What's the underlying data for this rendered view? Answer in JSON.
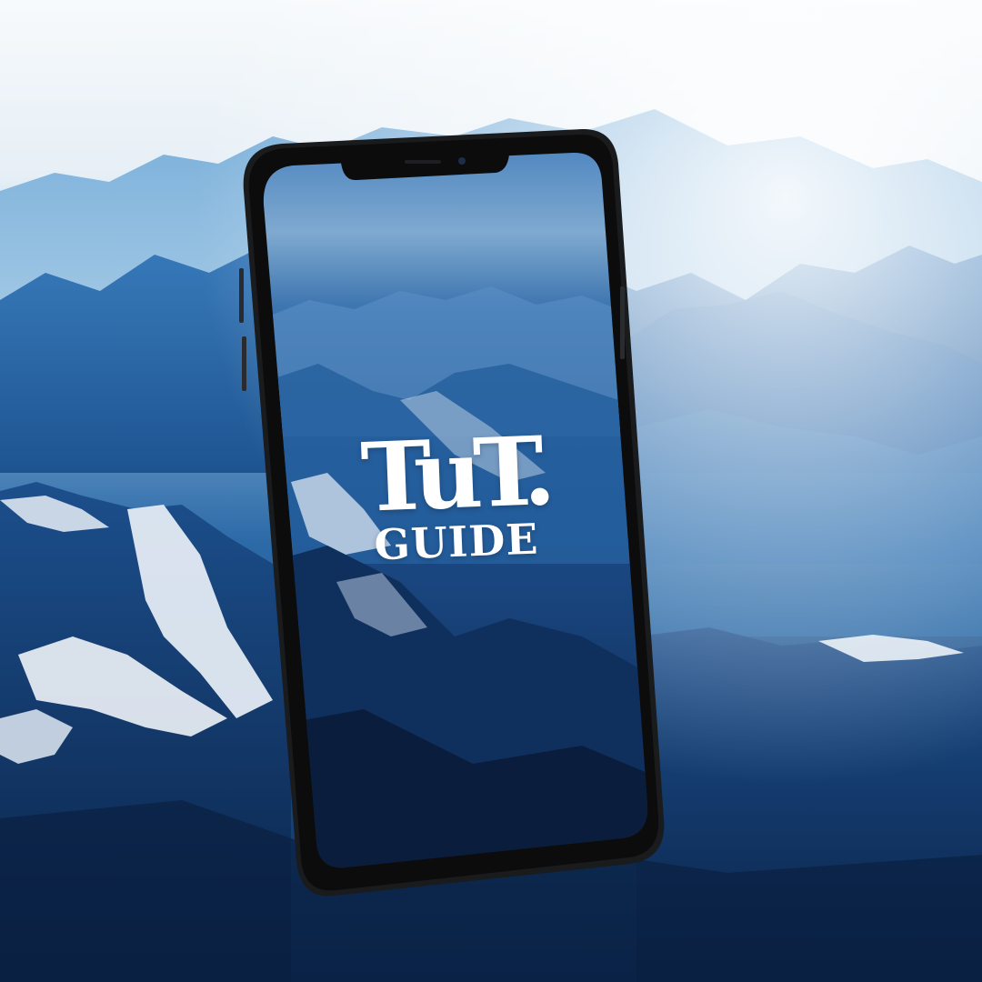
{
  "scene": {
    "description_icon": "mountain-landscape",
    "sky_color": "#f4f8fb",
    "haze_color": "#cfe2ef",
    "mountain_color_light": "#4e8fc8",
    "mountain_color_mid": "#1f5a9a",
    "mountain_color_dark": "#0b2a55",
    "snow_color": "#eef3f8"
  },
  "device": {
    "icon": "smartphone",
    "frame_color": "#1a1b1d",
    "screen_top_color": "#4f86c0",
    "screen_bottom_color": "#0c1f3d"
  },
  "app": {
    "logo_main": "TuT.",
    "logo_sub": "GUIDE",
    "logo_color": "#ffffff"
  }
}
